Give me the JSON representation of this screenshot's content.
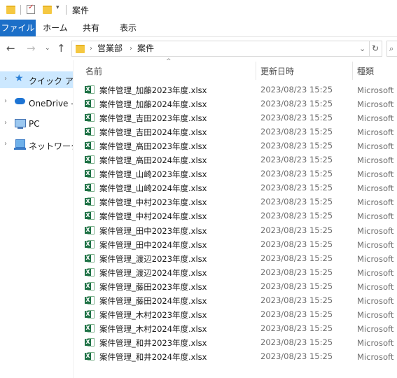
{
  "window": {
    "title": "案件"
  },
  "ribbon": {
    "tabs": [
      "ファイル",
      "ホーム",
      "共有",
      "表示"
    ]
  },
  "address": {
    "crumbs": [
      "営業部",
      "案件"
    ]
  },
  "nav": {
    "items": [
      {
        "label": "クイック アクセス",
        "icon": "quick-access-star-icon"
      },
      {
        "label": "OneDrive - 個人用",
        "icon": "onedrive-cloud-icon"
      },
      {
        "label": "PC",
        "icon": "pc-icon"
      },
      {
        "label": "ネットワーク",
        "icon": "network-icon"
      }
    ]
  },
  "columns": {
    "name": "名前",
    "date": "更新日時",
    "type": "種類"
  },
  "files": [
    {
      "name": "案件管理_加藤2023年度.xlsx",
      "date": "2023/08/23 15:25",
      "type": "Microsoft Excel ワークシート"
    },
    {
      "name": "案件管理_加藤2024年度.xlsx",
      "date": "2023/08/23 15:25",
      "type": "Microsoft Excel ワークシート"
    },
    {
      "name": "案件管理_吉田2023年度.xlsx",
      "date": "2023/08/23 15:25",
      "type": "Microsoft Excel ワークシート"
    },
    {
      "name": "案件管理_吉田2024年度.xlsx",
      "date": "2023/08/23 15:25",
      "type": "Microsoft Excel ワークシート"
    },
    {
      "name": "案件管理_高田2023年度.xlsx",
      "date": "2023/08/23 15:25",
      "type": "Microsoft Excel ワークシート"
    },
    {
      "name": "案件管理_高田2024年度.xlsx",
      "date": "2023/08/23 15:25",
      "type": "Microsoft Excel ワークシート"
    },
    {
      "name": "案件管理_山崎2023年度.xlsx",
      "date": "2023/08/23 15:25",
      "type": "Microsoft Excel ワークシート"
    },
    {
      "name": "案件管理_山崎2024年度.xlsx",
      "date": "2023/08/23 15:25",
      "type": "Microsoft Excel ワークシート"
    },
    {
      "name": "案件管理_中村2023年度.xlsx",
      "date": "2023/08/23 15:25",
      "type": "Microsoft Excel ワークシート"
    },
    {
      "name": "案件管理_中村2024年度.xlsx",
      "date": "2023/08/23 15:25",
      "type": "Microsoft Excel ワークシート"
    },
    {
      "name": "案件管理_田中2023年度.xlsx",
      "date": "2023/08/23 15:25",
      "type": "Microsoft Excel ワークシート"
    },
    {
      "name": "案件管理_田中2024年度.xlsx",
      "date": "2023/08/23 15:25",
      "type": "Microsoft Excel ワークシート"
    },
    {
      "name": "案件管理_渡辺2023年度.xlsx",
      "date": "2023/08/23 15:25",
      "type": "Microsoft Excel ワークシート"
    },
    {
      "name": "案件管理_渡辺2024年度.xlsx",
      "date": "2023/08/23 15:25",
      "type": "Microsoft Excel ワークシート"
    },
    {
      "name": "案件管理_藤田2023年度.xlsx",
      "date": "2023/08/23 15:25",
      "type": "Microsoft Excel ワークシート"
    },
    {
      "name": "案件管理_藤田2024年度.xlsx",
      "date": "2023/08/23 15:25",
      "type": "Microsoft Excel ワークシート"
    },
    {
      "name": "案件管理_木村2023年度.xlsx",
      "date": "2023/08/23 15:25",
      "type": "Microsoft Excel ワークシート"
    },
    {
      "name": "案件管理_木村2024年度.xlsx",
      "date": "2023/08/23 15:25",
      "type": "Microsoft Excel ワークシート"
    },
    {
      "name": "案件管理_和井2023年度.xlsx",
      "date": "2023/08/23 15:25",
      "type": "Microsoft Excel ワークシート"
    },
    {
      "name": "案件管理_和井2024年度.xlsx",
      "date": "2023/08/23 15:25",
      "type": "Microsoft Excel ワークシート"
    }
  ]
}
